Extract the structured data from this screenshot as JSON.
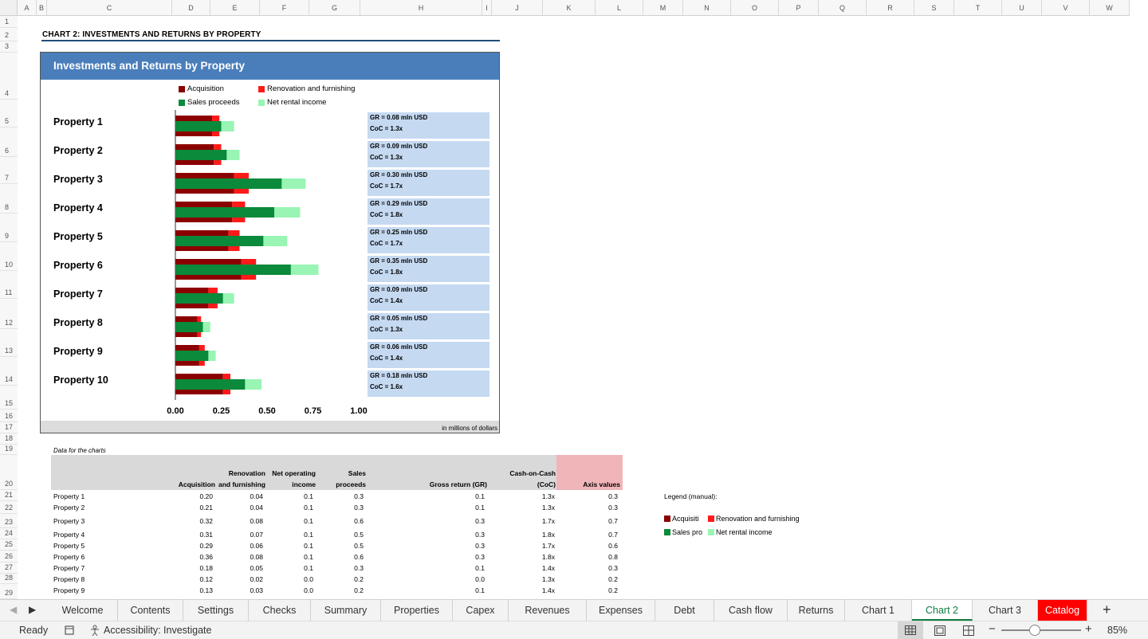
{
  "columns": [
    "A",
    "B",
    "C",
    "D",
    "E",
    "F",
    "G",
    "H",
    "I",
    "J",
    "K",
    "L",
    "M",
    "N",
    "O",
    "P",
    "Q",
    "R",
    "S",
    "T",
    "U",
    "V",
    "W"
  ],
  "rows": [
    "1",
    "2",
    "3",
    "4",
    "5",
    "6",
    "7",
    "8",
    "9",
    "10",
    "11",
    "12",
    "13",
    "14",
    "15",
    "16",
    "17",
    "18",
    "19",
    "20",
    "21",
    "22",
    "23",
    "24",
    "25",
    "26",
    "27",
    "28",
    "29"
  ],
  "heading": "CHART 2: INVESTMENTS AND RETURNS BY PROPERTY",
  "chart_data": {
    "type": "bar",
    "title": "Investments and Returns by Property",
    "categories": [
      "Property 1",
      "Property 2",
      "Property 3",
      "Property 4",
      "Property 5",
      "Property 6",
      "Property 7",
      "Property 8",
      "Property 9",
      "Property 10"
    ],
    "series": [
      {
        "name": "Acquisition",
        "color": "#8b0000",
        "values": [
          0.2,
          0.21,
          0.32,
          0.31,
          0.29,
          0.36,
          0.18,
          0.12,
          0.13,
          0.26
        ]
      },
      {
        "name": "Renovation and furnishing",
        "color": "#ff1a1a",
        "values": [
          0.04,
          0.04,
          0.08,
          0.07,
          0.06,
          0.08,
          0.05,
          0.02,
          0.03,
          0.04
        ]
      },
      {
        "name": "Sales proceeds",
        "color": "#0a8a3a",
        "values": [
          0.25,
          0.28,
          0.58,
          0.54,
          0.48,
          0.63,
          0.26,
          0.15,
          0.18,
          0.38
        ]
      },
      {
        "name": "Net rental income",
        "color": "#98f5b4",
        "values": [
          0.07,
          0.07,
          0.13,
          0.14,
          0.13,
          0.15,
          0.06,
          0.04,
          0.04,
          0.09
        ]
      }
    ],
    "gr_labels": [
      "GR = 0.08 mln USD",
      "GR = 0.09 mln USD",
      "GR = 0.30 mln USD",
      "GR = 0.29 mln USD",
      "GR = 0.25 mln USD",
      "GR = 0.35 mln USD",
      "GR = 0.09 mln USD",
      "GR = 0.05 mln USD",
      "GR = 0.06 mln USD",
      "GR = 0.18 mln USD"
    ],
    "coc_labels": [
      "CoC = 1.3x",
      "CoC = 1.3x",
      "CoC = 1.7x",
      "CoC = 1.8x",
      "CoC = 1.7x",
      "CoC = 1.8x",
      "CoC = 1.4x",
      "CoC = 1.3x",
      "CoC = 1.4x",
      "CoC = 1.6x"
    ],
    "xticks": [
      "0.00",
      "0.25",
      "0.50",
      "0.75",
      "1.00"
    ],
    "xlim": [
      0,
      1
    ],
    "unit_note": "in millions of dollars",
    "legend": "top"
  },
  "data_caption": "Data for the charts",
  "table": {
    "headers": {
      "acq": "Acquisition",
      "reno1": "Renovation",
      "reno2": "and furnishing",
      "noi1": "Net operating",
      "noi2": "income",
      "sales1": "Sales",
      "sales2": "proceeds",
      "gr": "Gross return (GR)",
      "coc1": "Cash-on-Cash",
      "coc2": "(CoC)",
      "axis": "Axis values"
    },
    "rows": [
      {
        "name": "Property 1",
        "acq": "0.20",
        "reno": "0.04",
        "noi": "0.1",
        "sales": "0.3",
        "gr": "0.1",
        "coc": "1.3x",
        "axis": "0.3"
      },
      {
        "name": "Property 2",
        "acq": "0.21",
        "reno": "0.04",
        "noi": "0.1",
        "sales": "0.3",
        "gr": "0.1",
        "coc": "1.3x",
        "axis": "0.3"
      },
      {
        "name": "Property 3",
        "acq": "0.32",
        "reno": "0.08",
        "noi": "0.1",
        "sales": "0.6",
        "gr": "0.3",
        "coc": "1.7x",
        "axis": "0.7"
      },
      {
        "name": "Property 4",
        "acq": "0.31",
        "reno": "0.07",
        "noi": "0.1",
        "sales": "0.5",
        "gr": "0.3",
        "coc": "1.8x",
        "axis": "0.7"
      },
      {
        "name": "Property 5",
        "acq": "0.29",
        "reno": "0.06",
        "noi": "0.1",
        "sales": "0.5",
        "gr": "0.3",
        "coc": "1.7x",
        "axis": "0.6"
      },
      {
        "name": "Property 6",
        "acq": "0.36",
        "reno": "0.08",
        "noi": "0.1",
        "sales": "0.6",
        "gr": "0.3",
        "coc": "1.8x",
        "axis": "0.8"
      },
      {
        "name": "Property 7",
        "acq": "0.18",
        "reno": "0.05",
        "noi": "0.1",
        "sales": "0.3",
        "gr": "0.1",
        "coc": "1.4x",
        "axis": "0.3"
      },
      {
        "name": "Property 8",
        "acq": "0.12",
        "reno": "0.02",
        "noi": "0.0",
        "sales": "0.2",
        "gr": "0.0",
        "coc": "1.3x",
        "axis": "0.2"
      },
      {
        "name": "Property 9",
        "acq": "0.13",
        "reno": "0.03",
        "noi": "0.0",
        "sales": "0.2",
        "gr": "0.1",
        "coc": "1.4x",
        "axis": "0.2"
      }
    ]
  },
  "legend_manual": {
    "label": "Legend (manual):",
    "items": [
      "Acquisiti",
      "Renovation and furnishing",
      "Sales pro",
      "Net rental income"
    ]
  },
  "tabs": [
    "Welcome",
    "Contents",
    "Settings",
    "Checks",
    "Summary",
    "Properties",
    "Capex",
    "Revenues",
    "Expenses",
    "Debt",
    "Cash flow",
    "Returns",
    "Chart 1",
    "Chart 2",
    "Chart 3",
    "Catalog"
  ],
  "active_tab": "Chart 2",
  "tab_add": "+",
  "status": {
    "ready": "Ready",
    "accessibility": "Accessibility: Investigate",
    "zoom": "85%"
  }
}
